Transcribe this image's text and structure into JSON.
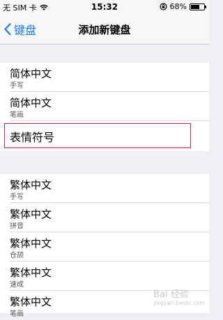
{
  "status_bar": {
    "carrier": "无 SIM 卡",
    "time": "15:32",
    "battery_percent": "68%",
    "battery_level": 0.68
  },
  "nav": {
    "back_label": "键盘",
    "title": "添加新键盘"
  },
  "group1": [
    {
      "title": "简体中文",
      "subtitle": "手写"
    },
    {
      "title": "简体中文",
      "subtitle": "笔画"
    },
    {
      "title": "表情符号",
      "subtitle": ""
    }
  ],
  "group2": [
    {
      "title": "繁体中文",
      "subtitle": "手写"
    },
    {
      "title": "繁体中文",
      "subtitle": "拼音"
    },
    {
      "title": "繁体中文",
      "subtitle": "仓颉"
    },
    {
      "title": "繁体中文",
      "subtitle": "速成"
    },
    {
      "title": "繁体中文",
      "subtitle": "笔画"
    }
  ],
  "watermark": {
    "text": "Bai 经验",
    "url": "jingyan.baidu.com"
  },
  "colors": {
    "accent": "#1a7cf5",
    "highlight": "#c8262b"
  }
}
